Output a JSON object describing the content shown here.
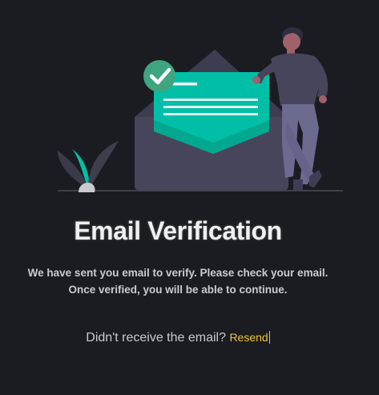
{
  "verification": {
    "title": "Email Verification",
    "message_line1": "We have sent you email to verify. Please check your email.",
    "message_line2": "Once verified, you will be able to continue.",
    "resend_prompt": "Didn't receive the email?",
    "resend_link": "Resend"
  },
  "colors": {
    "background": "#1b1c21",
    "accent": "#00bfa6",
    "link": "#f3c23a",
    "envelope": "#47455b"
  },
  "icons": {
    "check": "check-icon",
    "envelope": "envelope-icon"
  }
}
